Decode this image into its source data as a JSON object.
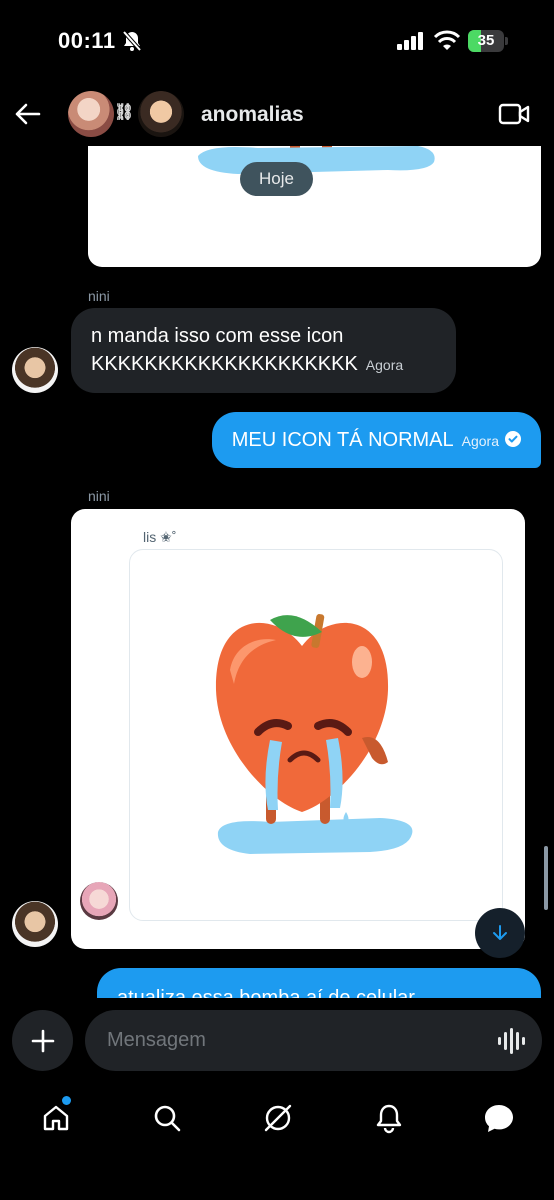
{
  "status_bar": {
    "time": "00:11",
    "battery": "35",
    "battery_level": 0.35
  },
  "header": {
    "title": "anomalias"
  },
  "chat": {
    "date_divider": "Hoje",
    "messages": [
      {
        "sender": "nini",
        "lines": [
          "n manda isso com esse  icon",
          "KKKKKKKKKKKKKKKKKKKK"
        ],
        "time": "Agora"
      },
      {
        "text": "MEU ICON TÁ NORMAL",
        "time": "Agora"
      },
      {
        "sender": "nini",
        "quoted_name": "lis ✬˚"
      },
      {
        "text": "atualiza essa bomba aí de celular"
      }
    ]
  },
  "composer": {
    "placeholder": "Mensagem"
  },
  "colors": {
    "accent": "#1d9bf0",
    "bubble_in": "#202327",
    "background": "#000000",
    "peach": "#f0693a",
    "leaf": "#3fa34d",
    "puddle": "#8fd3f5"
  }
}
